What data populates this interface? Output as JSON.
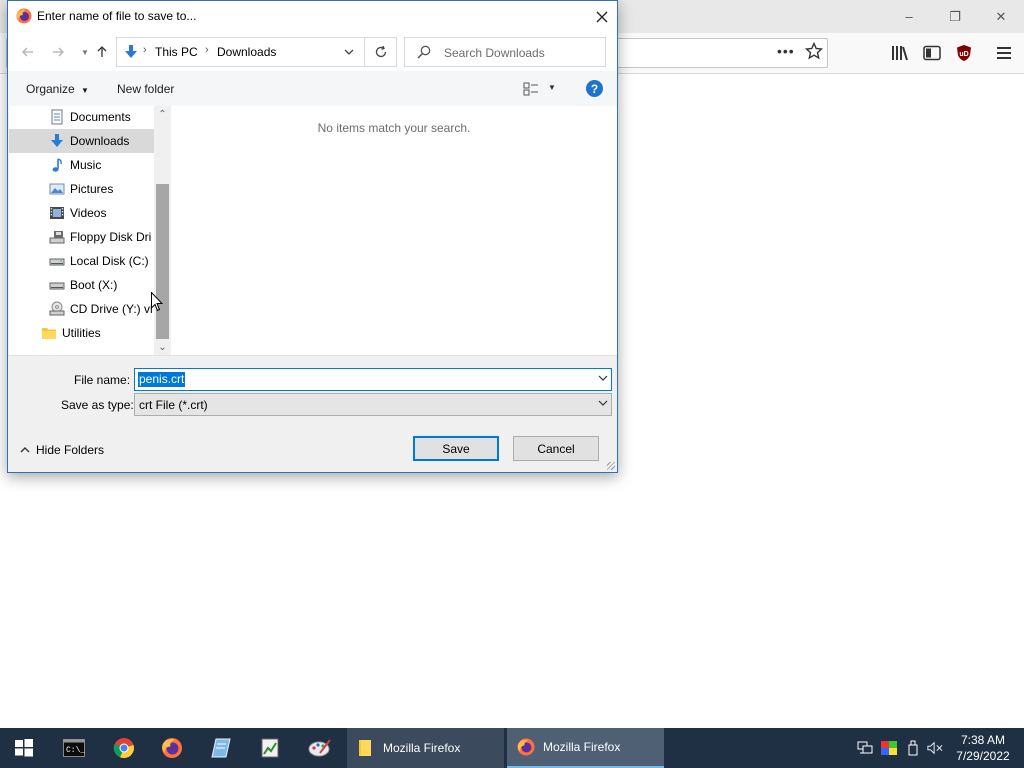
{
  "firefox": {
    "winbtns": [
      "–",
      "❐",
      "✕"
    ]
  },
  "dialog": {
    "title": "Enter name of file to save to...",
    "breadcrumb": [
      "This PC",
      "Downloads"
    ],
    "search_placeholder": "Search Downloads",
    "organize_label": "Organize",
    "new_folder_label": "New folder",
    "help_label": "?",
    "nav_items": [
      {
        "label": "Documents",
        "icon": "documents-icon"
      },
      {
        "label": "Downloads",
        "icon": "downloads-icon",
        "selected": true
      },
      {
        "label": "Music",
        "icon": "music-icon"
      },
      {
        "label": "Pictures",
        "icon": "pictures-icon"
      },
      {
        "label": "Videos",
        "icon": "videos-icon"
      },
      {
        "label": "Floppy Disk Dri",
        "icon": "floppy-drive-icon"
      },
      {
        "label": "Local Disk (C:)",
        "icon": "local-disk-icon"
      },
      {
        "label": "Boot (X:)",
        "icon": "boot-drive-icon"
      },
      {
        "label": "CD Drive (Y:) vi",
        "icon": "cd-drive-icon"
      },
      {
        "label": "Utilities",
        "icon": "folder-icon"
      }
    ],
    "empty_message": "No items match your search.",
    "file_name_label": "File name:",
    "file_name_value": "penis.crt",
    "save_type_label": "Save as type:",
    "save_type_value": "crt File (*.crt)",
    "hide_folders_label": "Hide Folders",
    "save_label": "Save",
    "cancel_label": "Cancel"
  },
  "taskbar": {
    "tasks": [
      {
        "label": "Mozilla Firefox",
        "icon": "folder-icon"
      },
      {
        "label": "Mozilla Firefox",
        "icon": "firefox-icon",
        "active": true
      }
    ],
    "time": "7:38 AM",
    "date": "7/29/2022"
  },
  "colors": {
    "accent": "#0078d7",
    "taskbar": "#1f2f44"
  }
}
